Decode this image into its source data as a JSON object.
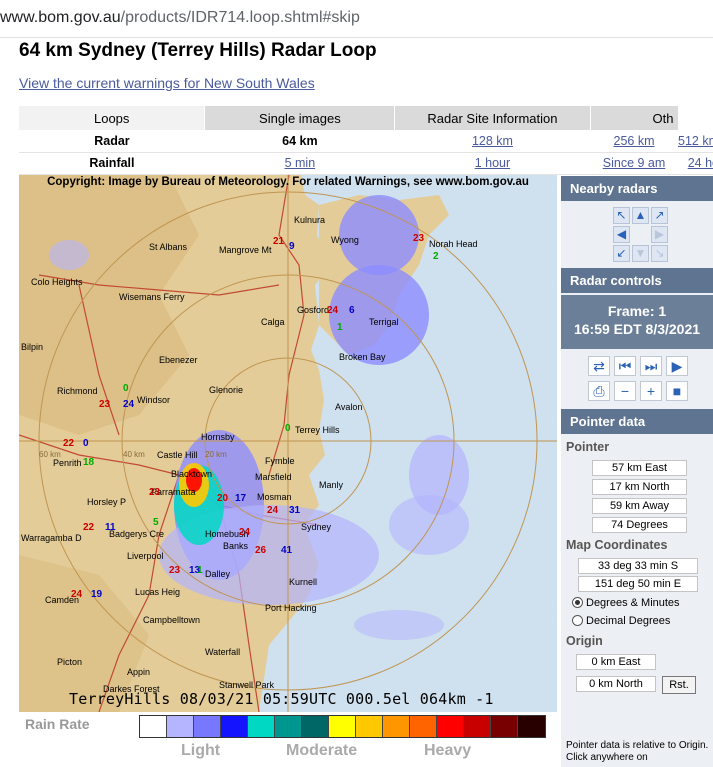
{
  "browser": {
    "url_host": "www.bom.gov.au",
    "url_path": "/products/IDR714.loop.shtml#skip"
  },
  "page": {
    "title": "64 km Sydney (Terrey Hills) Radar Loop",
    "warnings_link": "View the current warnings for New South Wales"
  },
  "tabs": [
    {
      "label": "Loops",
      "active": true
    },
    {
      "label": "Single images",
      "active": false
    },
    {
      "label": "Radar Site Information",
      "active": false
    },
    {
      "label": "Oth",
      "active": false
    }
  ],
  "range_rows": {
    "radar": {
      "label": "Radar",
      "options": [
        "64 km",
        "128 km",
        "256 km",
        "512 km"
      ],
      "current": "64 km"
    },
    "rainfall": {
      "label": "Rainfall",
      "options": [
        "5 min",
        "1 hour",
        "Since 9 am",
        "24 ho"
      ]
    }
  },
  "radar_image": {
    "copyright": "Copyright: Image by Bureau of Meteorology. For related Warnings, see www.bom.gov.au",
    "footer": "TerreyHills 08/03/21 05:59UTC 000.5el 064km -1",
    "places": [
      "Kulnura",
      "St Albans",
      "Mangrove Mt",
      "Wyong",
      "Norah Head",
      "Colo Heights",
      "Wisemans Ferry",
      "Gosford",
      "Terrigal",
      "Calga",
      "Bilpin",
      "Ebenezer",
      "Broken Bay",
      "Richmond",
      "Windsor",
      "Glenorie",
      "Avalon",
      "Hornsby",
      "Terrey Hills",
      "Penrith",
      "Castle Hill",
      "Fymble",
      "Blacktown",
      "Marsfield",
      "Manly",
      "Parramatta",
      "Mosman",
      "Horsley P",
      "Warragamba D",
      "Badgerys Cre",
      "Homebush",
      "Sydney",
      "Liverpool",
      "Banks",
      "Camden",
      "Lucas Heig",
      "Dalley",
      "Kurnell",
      "Port Hacking",
      "Campbelltown",
      "Picton",
      "Waterfall",
      "Appin",
      "Darkes Forest",
      "Stanwell Park"
    ],
    "range_labels": [
      "60 km",
      "40 km",
      "20 km"
    ],
    "obs_numbers": [
      "21",
      "9",
      "23",
      "2",
      "24",
      "6",
      "1",
      "23",
      "24",
      "0",
      "22",
      "0",
      "18",
      "23",
      "20",
      "17",
      "24",
      "31",
      "22",
      "11",
      "5",
      "24",
      "26",
      "41",
      "23",
      "13",
      "24",
      "19",
      "1",
      "0"
    ]
  },
  "legend": {
    "title": "Rain Rate",
    "colors": [
      "#ffffff",
      "#b4b4ff",
      "#7878ff",
      "#1414ff",
      "#00d8c3",
      "#009690",
      "#006666",
      "#ffff00",
      "#ffc800",
      "#ff9600",
      "#ff6400",
      "#ff0000",
      "#c80000",
      "#780000",
      "#280000"
    ],
    "labels": [
      "Light",
      "Moderate",
      "Heavy"
    ]
  },
  "sidebar": {
    "nearby_title": "Nearby radars",
    "nearby_icons": [
      "arrow-northwest-icon",
      "arrow-north-icon",
      "arrow-northeast-icon",
      "arrow-west-icon",
      "arrow-east-disabled-icon",
      "arrow-southwest-icon",
      "arrow-south-disabled-icon",
      "arrow-southeast-disabled-icon"
    ],
    "controls_title": "Radar controls",
    "frame_label": "Frame: 1",
    "frame_time": "16:59 EDT 8/3/2021",
    "control_icons": [
      "swap-icon",
      "first-frame-icon",
      "step-forward-icon",
      "play-icon",
      "print-icon",
      "zoom-out-icon",
      "zoom-in-icon",
      "stop-icon"
    ],
    "pointer_title": "Pointer data",
    "pointer_heading": "Pointer",
    "pointer": {
      "east": "57 km East",
      "north": "17 km North",
      "away": "59 km Away",
      "degrees": "74 Degrees"
    },
    "map_heading": "Map Coordinates",
    "coords": {
      "lat": "33 deg 33 min S",
      "lon": "151 deg 50 min E"
    },
    "radio_dm": "Degrees & Minutes",
    "radio_dd": "Decimal Degrees",
    "origin_heading": "Origin",
    "origin": {
      "east": "0 km East",
      "north": "0 km North"
    },
    "reset_label": "Rst.",
    "note": "Pointer data is relative to Origin. Click anywhere on"
  },
  "colors": {
    "header_bar": "#5f7490",
    "frame_box": "#6b7f99",
    "sea": "#cfe0ee",
    "land": "#e3cc98",
    "link": "#4a5a9c"
  }
}
